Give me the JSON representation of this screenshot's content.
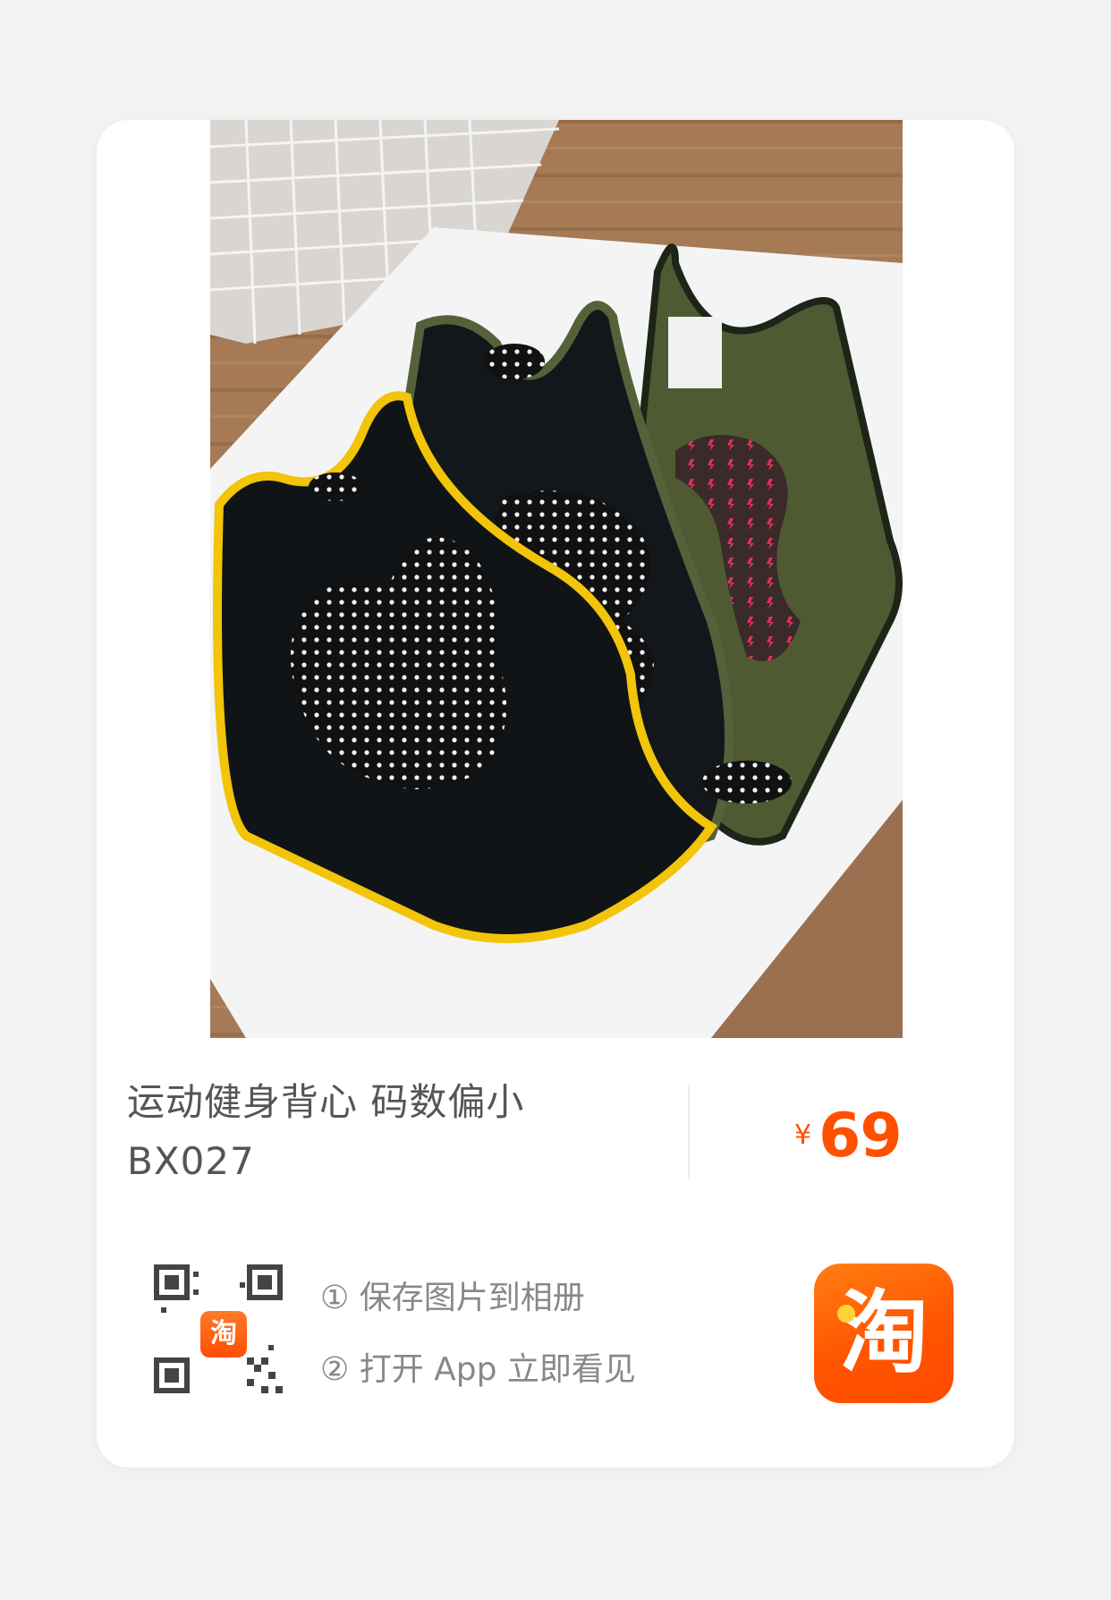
{
  "product": {
    "title_line1": "运动健身背心 码数偏小",
    "title_line2": "BX027",
    "price_currency": "¥",
    "price_amount": "69",
    "image_subject": "three racerback sports tank tops on a white table"
  },
  "share": {
    "qr_badge": "淘",
    "step1": "① 保存图片到相册",
    "step2": "② 打开 App 立即看见",
    "app_logo": "淘"
  },
  "colors": {
    "accent": "#ff5000",
    "text": "#555555",
    "muted": "#888888",
    "card": "#ffffff",
    "background": "#f2f2f2"
  },
  "icons": [
    "qr-code-icon",
    "taobao-badge-icon",
    "taobao-app-icon"
  ]
}
